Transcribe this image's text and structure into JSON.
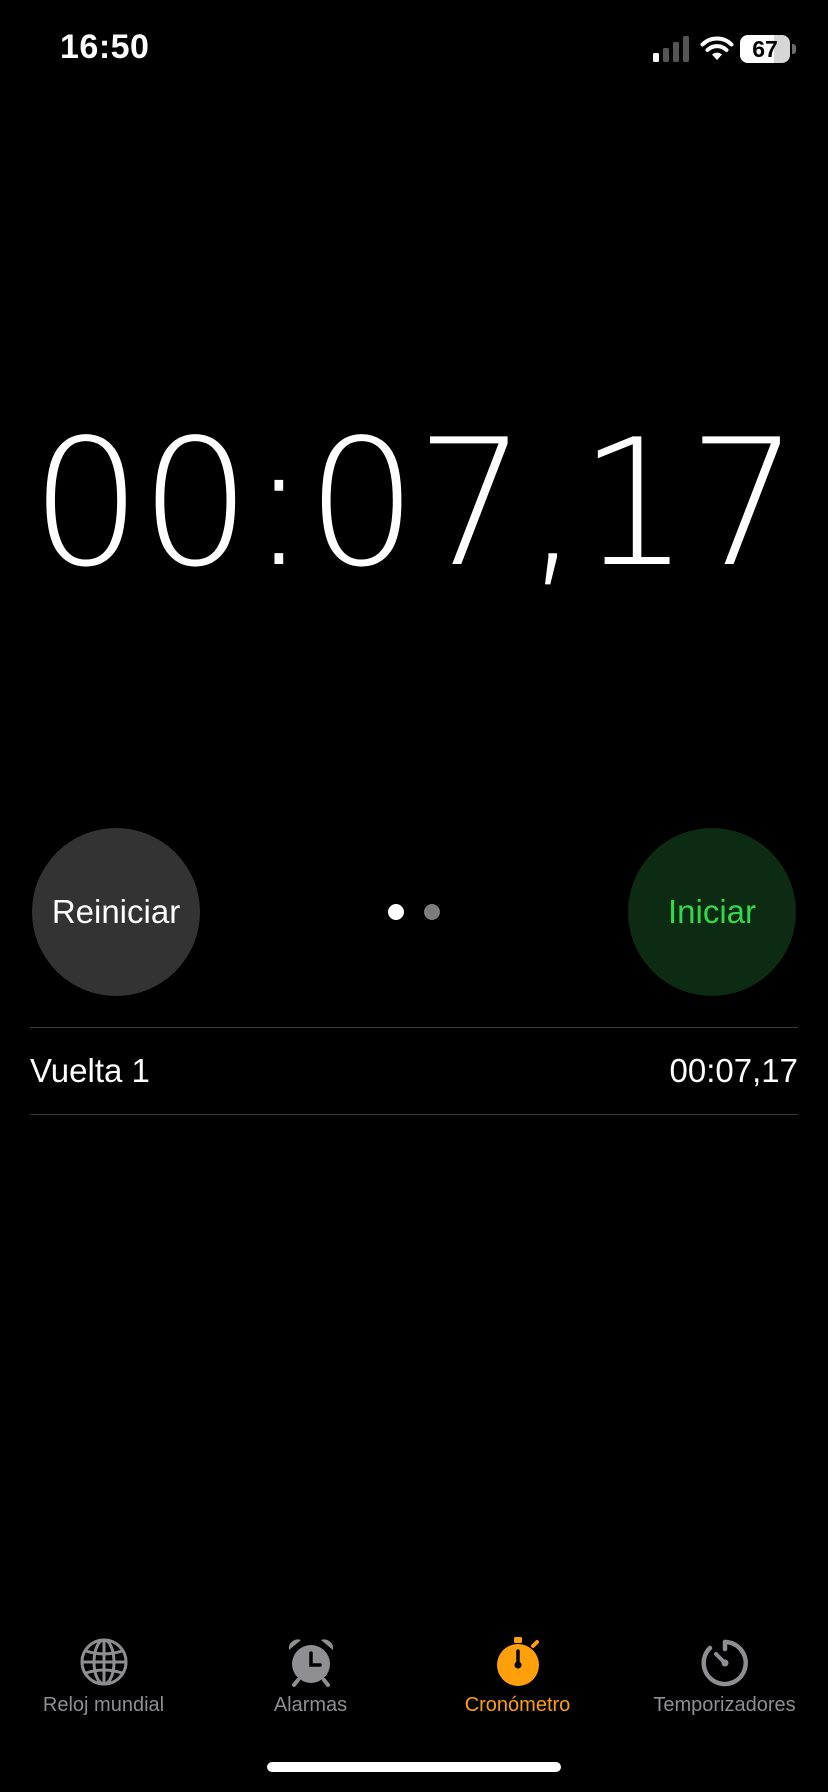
{
  "status_bar": {
    "time": "16:50",
    "battery_level": "67",
    "battery_fraction": 0.67,
    "signal_bars_active": 1,
    "signal_bars_total": 4
  },
  "stopwatch": {
    "display": "00:07,17"
  },
  "controls": {
    "reset_label": "Reiniciar",
    "start_label": "Iniciar",
    "page_count": 2,
    "active_page": 1
  },
  "laps": [
    {
      "label": "Vuelta 1",
      "time": "00:07,17"
    }
  ],
  "tab_bar": {
    "tabs": [
      {
        "label": "Reloj mundial",
        "icon": "globe-icon",
        "active": false
      },
      {
        "label": "Alarmas",
        "icon": "alarm-clock-icon",
        "active": false
      },
      {
        "label": "Cronómetro",
        "icon": "stopwatch-icon",
        "active": true
      },
      {
        "label": "Temporizadores",
        "icon": "timer-icon",
        "active": false
      }
    ]
  },
  "colors": {
    "background": "#000000",
    "accent_orange": "#ff9f0a",
    "start_green": "#32d74b",
    "start_bg": "#0d2a12",
    "reset_bg": "#333333",
    "inactive_tab": "#8e8e93"
  }
}
